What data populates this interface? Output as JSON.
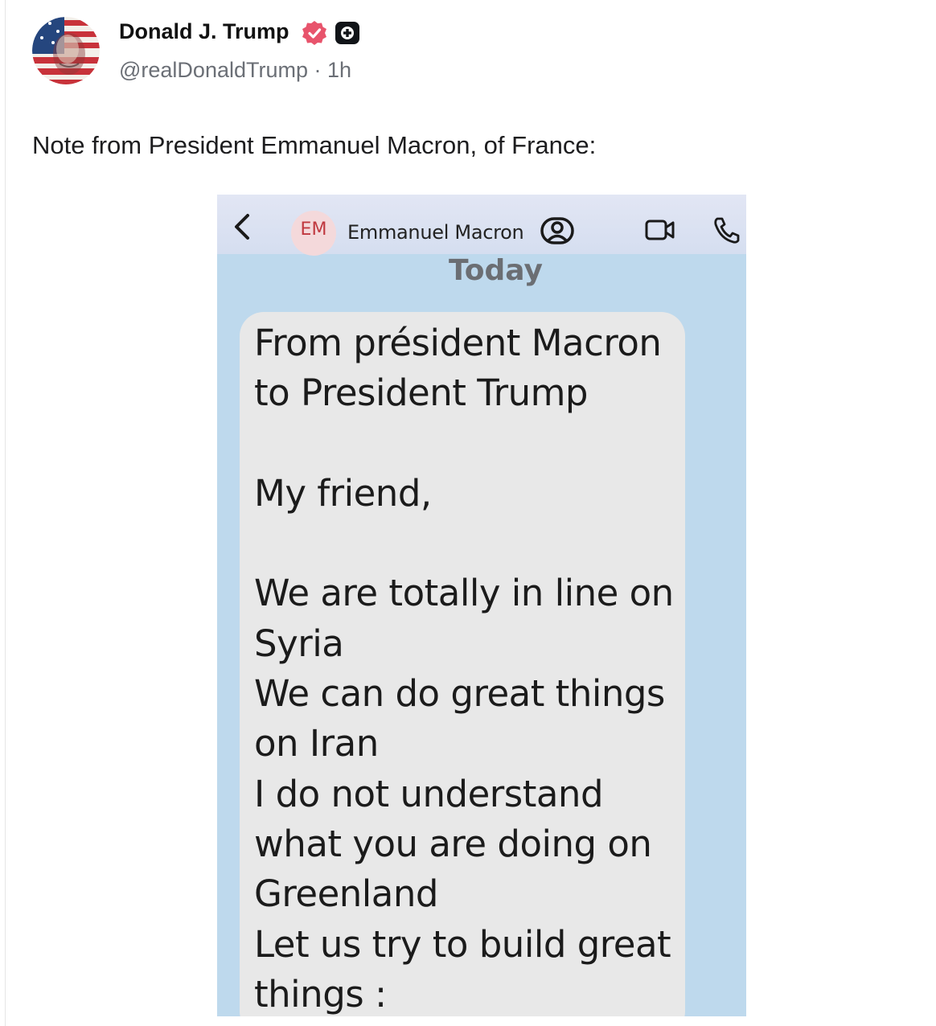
{
  "author": {
    "display_name": "Donald J. Trump",
    "handle": "@realDonaldTrump",
    "separator": "·",
    "time": "1h",
    "verified_icon": "verified-badge-icon",
    "plus_icon": "plus-badge-icon"
  },
  "post": {
    "text": "Note from President Emmanuel Macron, of France:"
  },
  "screenshot": {
    "header": {
      "contact_initials": "EM",
      "contact_name": "Emmanuel Macron"
    },
    "date_separator": "Today",
    "message_lines": [
      "From président Macron",
      "to President Trump",
      "",
      "My friend,",
      "",
      "We are totally in line on",
      "Syria",
      "We can do great things",
      "on Iran",
      "I do not understand",
      "what you are doing on",
      "Greenland",
      "Let us try to build great",
      "things :"
    ]
  },
  "colors": {
    "verified_badge": "#e8546c",
    "chat_background": "#bed9ed",
    "bubble": "#e8e8e8",
    "contact_avatar_bg": "#f4d9db",
    "contact_avatar_text": "#c0383f"
  }
}
